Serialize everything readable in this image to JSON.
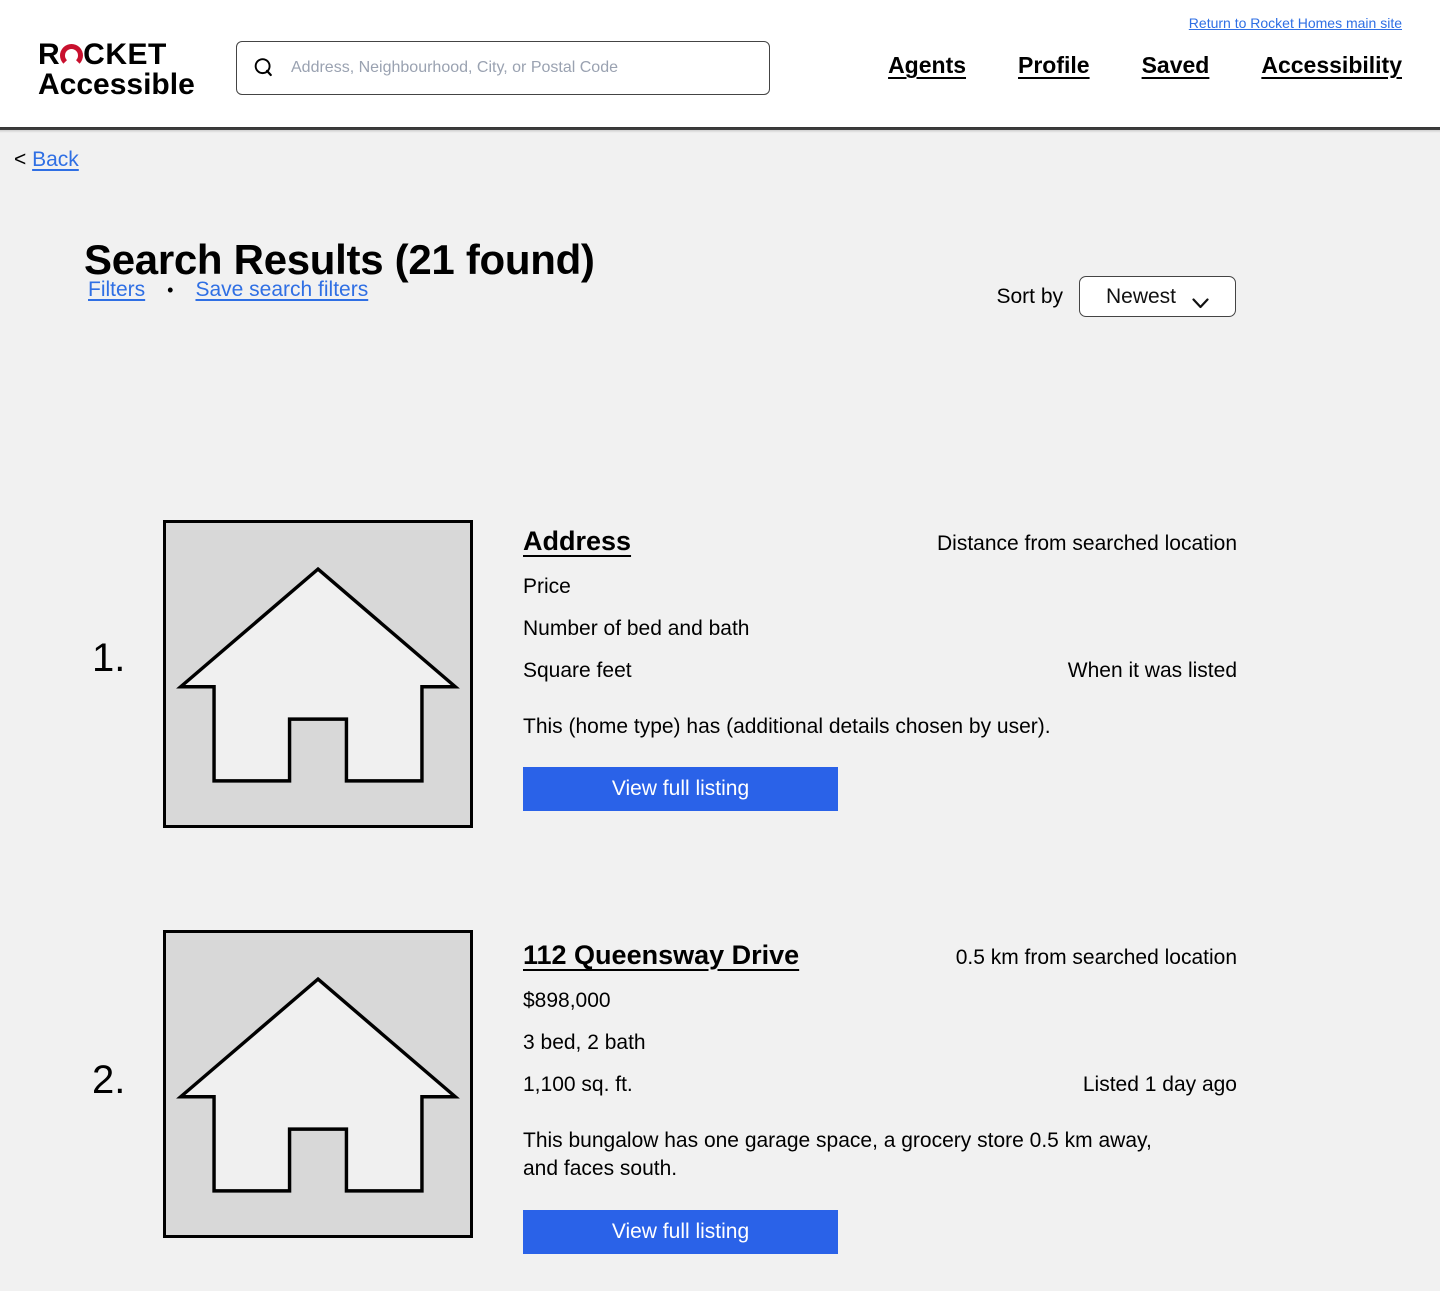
{
  "brand": {
    "line1_left": "R",
    "line1_right": "CKET",
    "line2": "Accessible",
    "ring_color": "#c8102e"
  },
  "search": {
    "placeholder": "Address, Neighbourhood, City, or Postal Code",
    "value": ""
  },
  "header": {
    "return_link": "Return to Rocket Homes main site",
    "nav": [
      {
        "label": "Agents"
      },
      {
        "label": "Profile"
      },
      {
        "label": "Saved"
      },
      {
        "label": "Accessibility"
      }
    ]
  },
  "back": {
    "chevron": "<",
    "label": "Back"
  },
  "main": {
    "title": "Search Results (21 found)",
    "filters_link": "Filters",
    "separator": "•",
    "save_filters_link": "Save search filters",
    "sort_label": "Sort by",
    "sort_value": "Newest"
  },
  "listings": [
    {
      "number": "1.",
      "address": "Address",
      "distance": "Distance from searched location",
      "price": "Price",
      "beds_baths": "Number of bed and bath",
      "square_feet": "Square feet",
      "listed": "When it was listed",
      "description": "This (home type) has (additional details chosen by user).",
      "button_label": "View full listing"
    },
    {
      "number": "2.",
      "address": "112 Queensway Drive",
      "distance": "0.5 km from searched location",
      "price": "$898,000",
      "beds_baths": "3 bed, 2 bath",
      "square_feet": "1,100 sq. ft.",
      "listed": "Listed 1 day ago",
      "description": "This bungalow has one garage space, a grocery store 0.5 km away, and faces south.",
      "button_label": "View full listing"
    }
  ],
  "colors": {
    "link_blue": "#2f6fe4",
    "button_blue": "#2a62e8",
    "page_bg": "#f1f1f1",
    "thumb_bg": "#d8d8d8",
    "brand_red": "#c8102e"
  }
}
